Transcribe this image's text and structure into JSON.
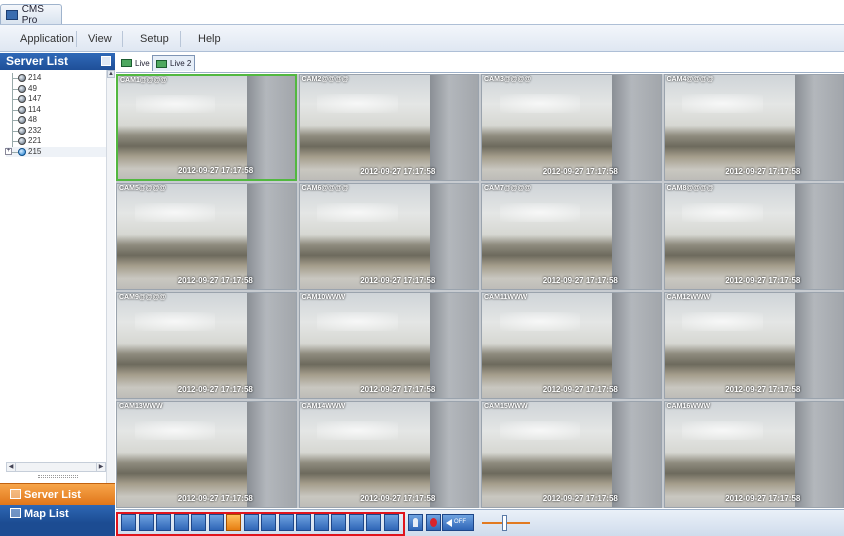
{
  "window": {
    "title": "CMS Pro"
  },
  "menu": [
    "Application",
    "View",
    "Setup",
    "Help"
  ],
  "sidebar": {
    "header": "Server List",
    "servers": [
      "214",
      "49",
      "147",
      "114",
      "48",
      "232",
      "221",
      "215"
    ],
    "selected_index": 7,
    "buttons": {
      "server_list": "Server List",
      "map_list": "Map List"
    }
  },
  "tabs": [
    "Live 1",
    "Live 2"
  ],
  "active_tab_index": 1,
  "cameras": [
    {
      "label": "CAM1@@@@",
      "timestamp": "2012-09-27 17:17:58"
    },
    {
      "label": "CAM2@@@@",
      "timestamp": "2012-09-27 17:17:58"
    },
    {
      "label": "CAM3@@@@",
      "timestamp": "2012-09-27 17:17:58"
    },
    {
      "label": "CAM4@@@@",
      "timestamp": "2012-09-27 17:17:58"
    },
    {
      "label": "CAM5@@@@",
      "timestamp": "2012-09-27 17:17:58"
    },
    {
      "label": "CAM6@@@@",
      "timestamp": "2012-09-27 17:17:58"
    },
    {
      "label": "CAM7@@@@",
      "timestamp": "2012-09-27 17:17:58"
    },
    {
      "label": "CAM8@@@@",
      "timestamp": "2012-09-27 17:17:58"
    },
    {
      "label": "CAM9@@@@",
      "timestamp": "2012-09-27 17:17:58"
    },
    {
      "label": "CAM10WWW",
      "timestamp": "2012-09-27 17:17:58"
    },
    {
      "label": "CAM11WWW",
      "timestamp": "2012-09-27 17:17:58"
    },
    {
      "label": "CAM12WWW",
      "timestamp": "2012-09-27 17:17:58"
    },
    {
      "label": "CAM13WWW",
      "timestamp": "2012-09-27 17:17:58"
    },
    {
      "label": "CAM14WWW",
      "timestamp": "2012-09-27 17:17:58"
    },
    {
      "label": "CAM15WWW",
      "timestamp": "2012-09-27 17:17:58"
    },
    {
      "label": "CAM16WWW",
      "timestamp": "2012-09-27 17:17:58"
    }
  ],
  "selected_camera_index": 0,
  "toolbar": {
    "layout_buttons": [
      "1",
      "4",
      "6",
      "8",
      "9",
      "10",
      "16",
      "20",
      "25",
      "32",
      "36",
      "40",
      "49",
      "64",
      "81",
      "fullscreen"
    ],
    "active_layout_index": 6,
    "audio_label": "OFF",
    "volume_level": 0.45
  },
  "colors": {
    "header_blue": "#1f4f98",
    "accent_orange": "#e0761a",
    "selection_green": "#52b840",
    "highlight_red": "#e0141c"
  }
}
